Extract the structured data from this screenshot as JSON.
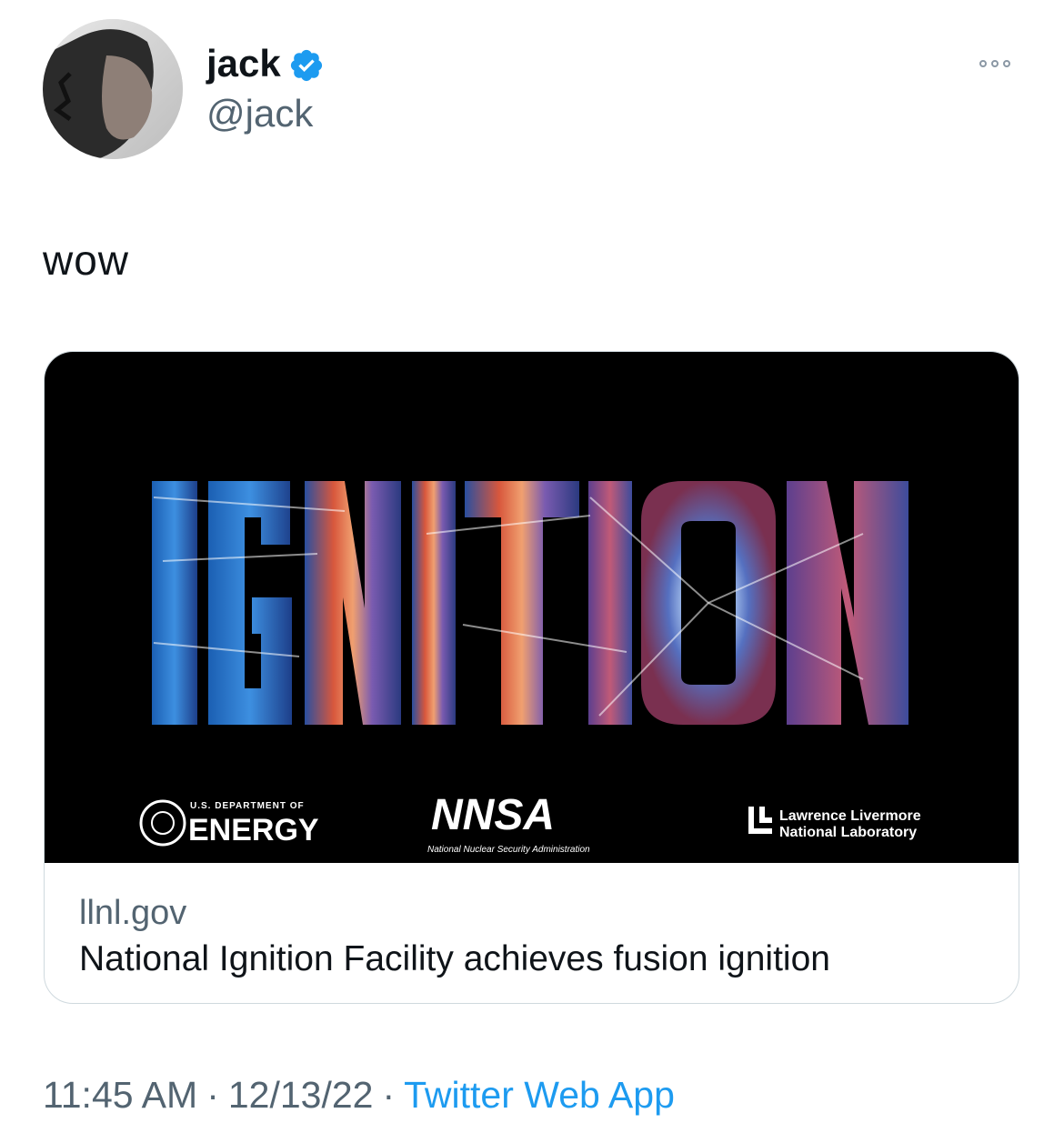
{
  "author": {
    "display_name": "jack",
    "handle": "@jack",
    "verified": true,
    "avatar": "avatar-photo"
  },
  "tweet": {
    "text": "wow"
  },
  "card": {
    "image": {
      "headline": "IGNITION",
      "logos": {
        "doe_small": "U.S. DEPARTMENT OF",
        "doe_big": "ENERGY",
        "nnsa": "NNSA",
        "nnsa_sub": "National Nuclear Security Administration",
        "llnl_line1": "Lawrence Livermore",
        "llnl_line2": "National Laboratory"
      }
    },
    "domain": "llnl.gov",
    "title": "National Ignition Facility achieves fusion ignition"
  },
  "meta": {
    "time": "11:45 AM",
    "separator": "·",
    "date": "12/13/22",
    "source": "Twitter Web App"
  },
  "colors": {
    "link": "#1d9bf0",
    "secondary_text": "#536471",
    "verified": "#1d9bf0"
  },
  "icons": {
    "verified": "verified-badge-icon",
    "more": "more-options-icon"
  }
}
